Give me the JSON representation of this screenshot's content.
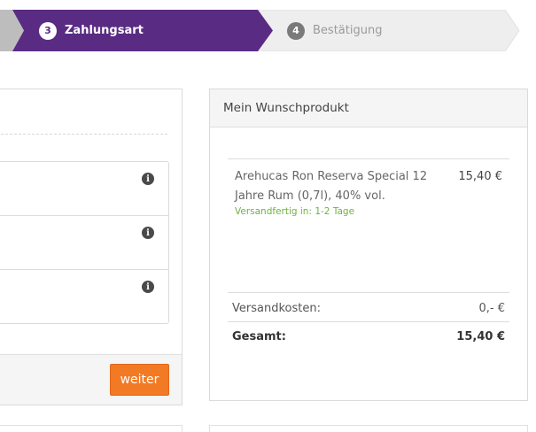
{
  "steps": [
    {
      "number": "3",
      "label": "Zahlungsart",
      "state": "active"
    },
    {
      "number": "4",
      "label": "Bestätigung",
      "state": "upcoming"
    }
  ],
  "colors": {
    "active_step": "#5a2b83",
    "upcoming_step": "#eeeeee",
    "previous_step": "#bdbdbd",
    "button": "#f37a24",
    "availability": "#6cb33e"
  },
  "payment": {
    "options": [
      {
        "icon": "info-icon"
      },
      {
        "icon": "info-icon"
      },
      {
        "icon": "info-icon"
      }
    ],
    "next_button": "weiter"
  },
  "summary": {
    "title": "Mein Wunschprodukt",
    "product": {
      "name": "Arehucas Ron Reserva Special 12 Jahre Rum (0,7l), 40% vol.",
      "price": "15,40 €",
      "availability": "Versandfertig in: 1-2 Tage"
    },
    "shipping_label": "Versandkosten:",
    "shipping_value": "0,- €",
    "total_label": "Gesamt:",
    "total_value": "15,40 €"
  }
}
